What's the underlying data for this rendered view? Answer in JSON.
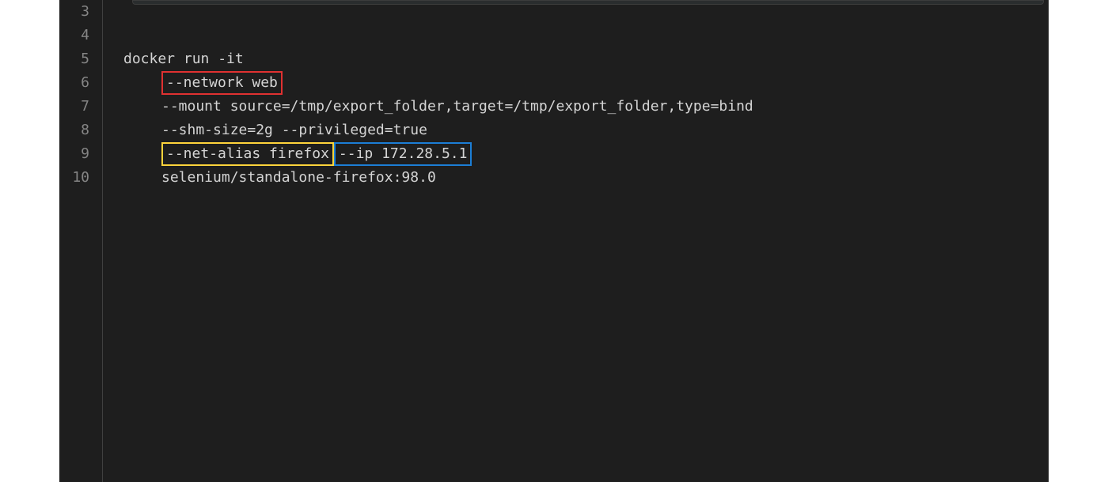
{
  "gutter": {
    "start": 3,
    "lines": [
      "3",
      "4",
      "5",
      "6",
      "7",
      "8",
      "9",
      "10"
    ]
  },
  "code": {
    "line5": "docker run -it",
    "line6_boxed": "--network web",
    "line7": "--mount source=/tmp/export_folder,target=/tmp/export_folder,type=bind",
    "line8": "--shm-size=2g --privileged=true",
    "line9_box1": "--net-alias firefox",
    "line9_box2": "--ip 172.28.5.1",
    "line10": "selenium/standalone-firefox:98.0"
  },
  "highlights": {
    "red": "#e03131",
    "yellow": "#ffd43b",
    "blue": "#1c7ed6"
  }
}
